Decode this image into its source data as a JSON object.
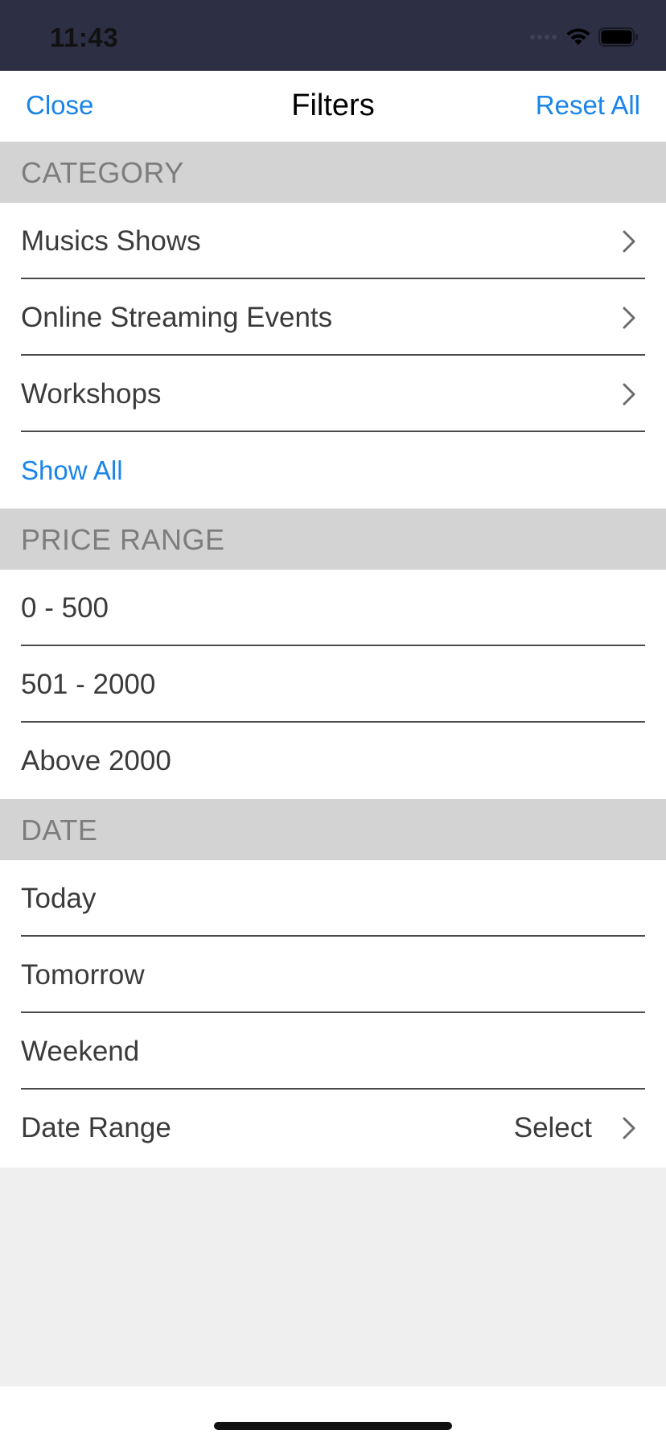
{
  "status_bar": {
    "time": "11:43"
  },
  "nav": {
    "close_label": "Close",
    "title": "Filters",
    "reset_label": "Reset All"
  },
  "category": {
    "header": "CATEGORY",
    "items": [
      {
        "label": "Musics Shows"
      },
      {
        "label": "Online Streaming Events"
      },
      {
        "label": "Workshops"
      }
    ],
    "show_all_label": "Show All"
  },
  "price_range": {
    "header": "PRICE RANGE",
    "items": [
      {
        "label": "0 - 500"
      },
      {
        "label": "501 - 2000"
      },
      {
        "label": "Above 2000"
      }
    ]
  },
  "date": {
    "header": "DATE",
    "items": [
      {
        "label": "Today"
      },
      {
        "label": "Tomorrow"
      },
      {
        "label": "Weekend"
      }
    ],
    "range": {
      "label": "Date Range",
      "value": "Select"
    }
  },
  "icons": {
    "chevron": "chevron-right-icon",
    "wifi": "wifi-icon",
    "battery": "battery-icon",
    "cellular": "cellular-signal-icon"
  },
  "colors": {
    "accent": "#1a84e8",
    "status_bar": "#2d3044",
    "section_header_bg": "#d3d3d3",
    "section_header_text": "#7d7d7d",
    "empty_area": "#efefef"
  }
}
